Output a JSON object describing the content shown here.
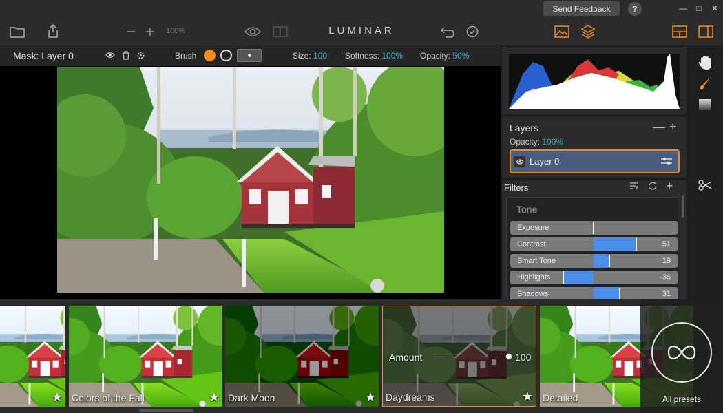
{
  "titlebar": {
    "feedback_label": "Send Feedback",
    "help_label": "?",
    "minimize": "—",
    "maximize": "□",
    "close": "✕"
  },
  "toolbar": {
    "app_title": "LUMINAR",
    "zoom": "100%",
    "icons": [
      "folder-icon",
      "share-icon",
      "zoom-out-icon",
      "zoom-in-icon",
      "preview-eye-icon",
      "compare-icon",
      "undo-icon",
      "history-icon",
      "image-icon",
      "layers-icon",
      "layout-icon",
      "panel-icon"
    ],
    "accent": "#f38c1e"
  },
  "mask_bar": {
    "title": "Mask: Layer 0",
    "brush_label": "Brush",
    "size_label": "Size:",
    "size_value": "100",
    "softness_label": "Softness:",
    "softness_value": "100%",
    "opacity_label": "Opacity:",
    "opacity_value": "50%"
  },
  "layers": {
    "title": "Layers",
    "opacity_label": "Opacity:",
    "opacity_value": "100%",
    "items": [
      {
        "name": "Layer 0"
      }
    ]
  },
  "filters": {
    "title": "Filters",
    "group": "Tone",
    "sliders": [
      {
        "label": "Exposure",
        "value": "",
        "fraction": 0.0
      },
      {
        "label": "Contrast",
        "value": "51",
        "fraction": 0.51
      },
      {
        "label": "Smart Tone",
        "value": "19",
        "fraction": 0.19
      },
      {
        "label": "Highlights",
        "value": "-36",
        "fraction": -0.36
      },
      {
        "label": "Shadows",
        "value": "31",
        "fraction": 0.31
      }
    ],
    "slider_color": "#4a8ee8"
  },
  "presets": {
    "items": [
      {
        "label": "",
        "style": "vivid"
      },
      {
        "label": "Colors of the Fall",
        "style": "vivid"
      },
      {
        "label": "Dark Moon",
        "style": "dark"
      },
      {
        "label": "Daydreams",
        "style": "dim",
        "selected": true
      },
      {
        "label": "Detailed",
        "style": "vivid"
      }
    ],
    "amount_label": "Amount",
    "amount_value": "100",
    "amount_fraction": 1.0,
    "all_presets_label": "All presets"
  },
  "tools": [
    "hand-icon",
    "brush-icon",
    "gradient-icon",
    "scissors-icon"
  ]
}
